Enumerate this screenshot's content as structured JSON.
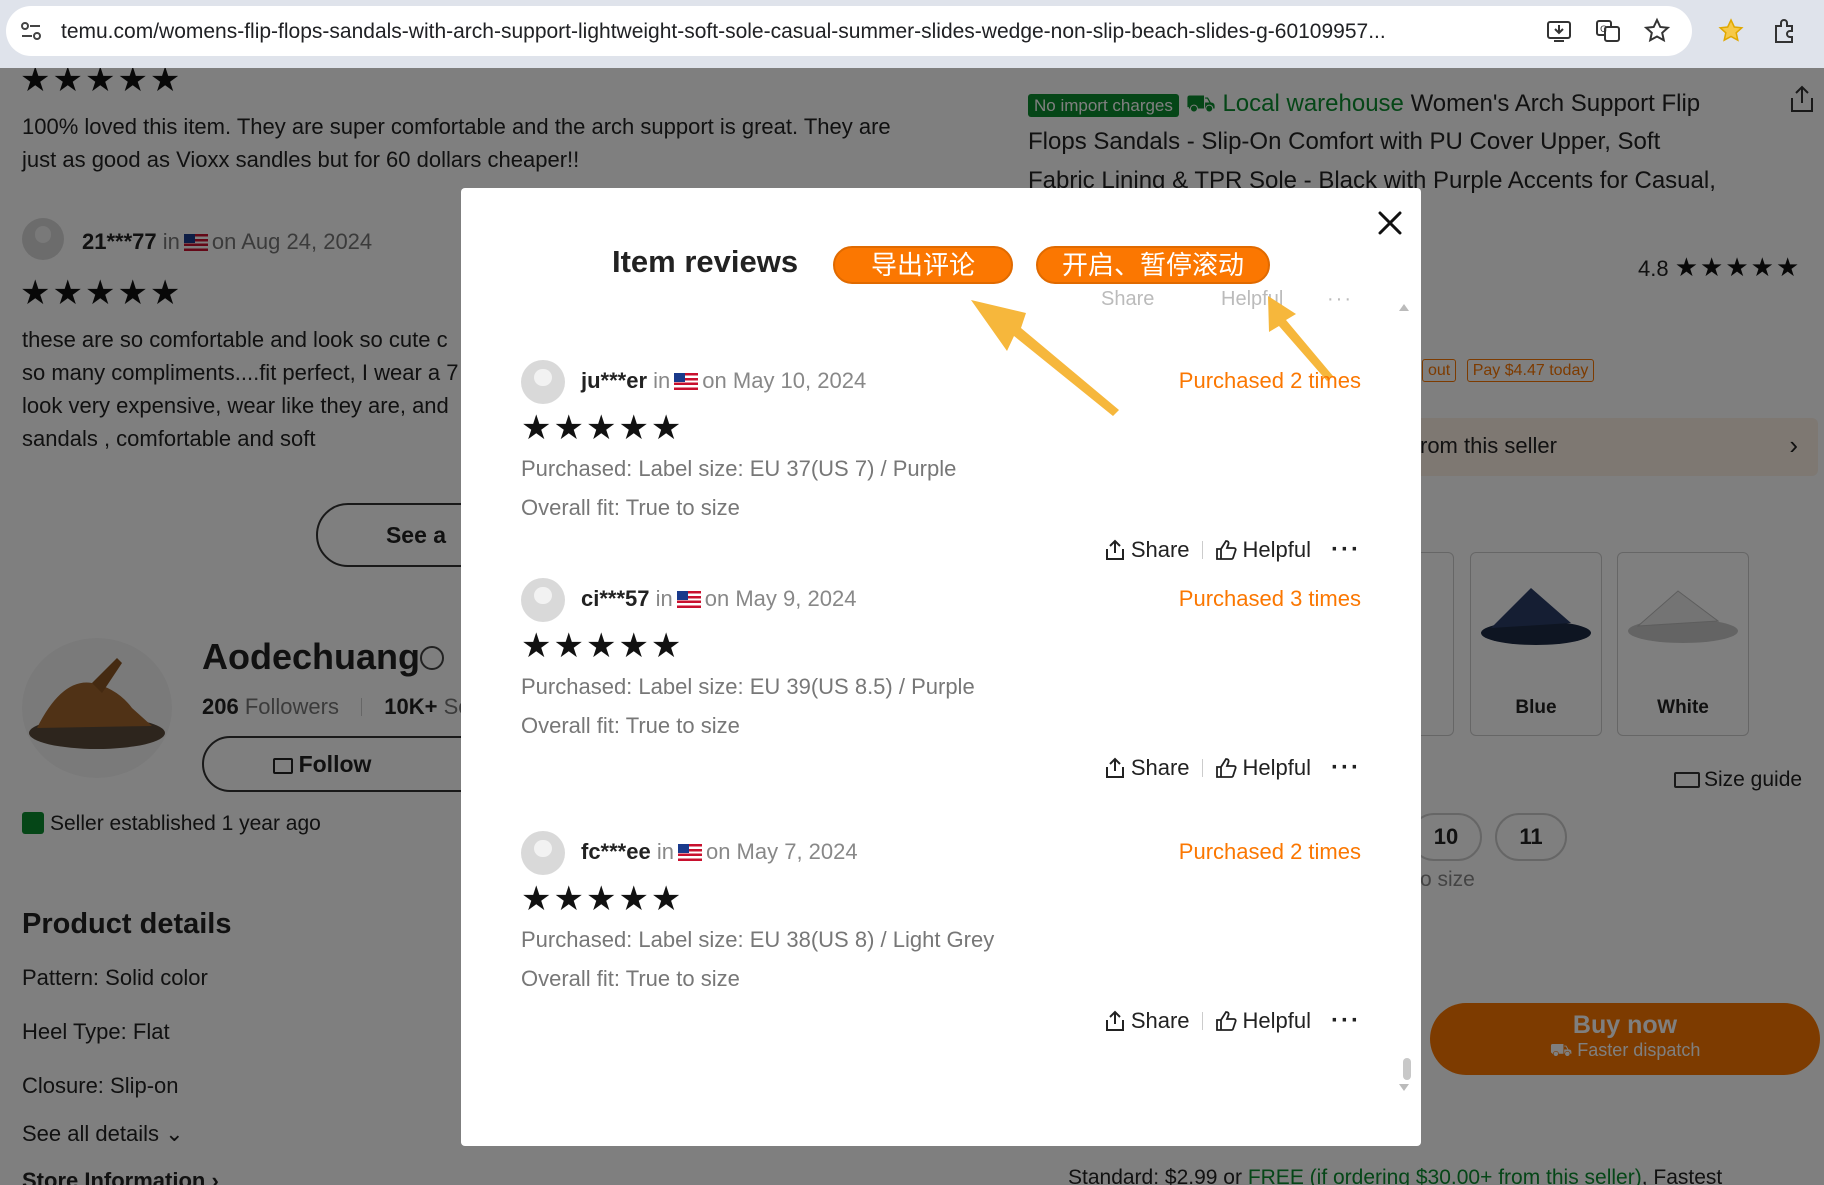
{
  "browser": {
    "url": "temu.com/womens-flip-flops-sandals-with-arch-support-lightweight-soft-sole-casual-summer-slides-wedge-non-slip-beach-slides-g-60109957..."
  },
  "background": {
    "top_review": {
      "text_line1": "100% loved this item. They are super comfortable and the arch support is great. They are",
      "text_line2": "just as good as Vioxx sandles but for 60 dollars cheaper!!"
    },
    "second_review": {
      "name": "21***77",
      "in": "in",
      "date": "on Aug 24, 2024",
      "lines": [
        "these are so comfortable and look so cute c",
        "so many compliments....fit perfect, I wear a 7",
        "look very expensive, wear like they are, and",
        "sandals , comfortable and soft"
      ]
    },
    "see_all_label": "See a",
    "store": {
      "name": "Aodechuang",
      "followers_count": "206",
      "followers_label": "Followers",
      "sold_count": "10K+",
      "sold_label": "Sc",
      "follow_label": "Follow",
      "established": "Seller established 1 year ago"
    },
    "product_details": {
      "heading": "Product details",
      "items": [
        "Pattern: Solid color",
        "Heel Type: Flat",
        "Closure: Slip-on"
      ],
      "see_all": "See all details",
      "store_info": "Store Information"
    },
    "product": {
      "no_import": "No import charges",
      "local_warehouse": "Local warehouse",
      "title_line1": "Women's Arch Support Flip",
      "title_line2": "Flops Sandals - Slip-On Comfort with PU Cover Upper, Soft",
      "title_line3": "Fabric Lining & TPR Sole - Black with Purple Accents for Casual,",
      "rating": "4.8",
      "pay_out": "out",
      "pay_today": "Pay $4.47 today",
      "from_seller": "rom this seller",
      "color_tiles": [
        "Blue",
        "White"
      ],
      "size_guide": "Size guide",
      "sizes": [
        "10",
        "11"
      ],
      "size_note": "o size",
      "buy_now": "Buy now",
      "faster_dispatch": "Faster dispatch",
      "shipping_prefix": "Standard: $2.99 or",
      "shipping_free": "FREE (if ordering $30.00+ from this seller)",
      "shipping_suffix": ", Fastest"
    }
  },
  "modal": {
    "title": "Item reviews",
    "export_button": "导出评论",
    "scroll_button": "开启、暂停滚动",
    "ghost_share": "Share",
    "ghost_helpful": "Helpful",
    "reviews": [
      {
        "name": "ju***er",
        "in": "in",
        "date": "on May 10, 2024",
        "purchased_times": "Purchased 2 times",
        "stars": "★★★★★",
        "purchase_info": "Purchased: Label size: EU 37(US 7) / Purple",
        "fit": "Overall fit: True to size",
        "share": "Share",
        "helpful": "Helpful"
      },
      {
        "name": "ci***57",
        "in": "in",
        "date": "on May 9, 2024",
        "purchased_times": "Purchased 3 times",
        "stars": "★★★★★",
        "purchase_info": "Purchased: Label size: EU 39(US 8.5) / Purple",
        "fit": "Overall fit: True to size",
        "share": "Share",
        "helpful": "Helpful"
      },
      {
        "name": "fc***ee",
        "in": "in",
        "date": "on May 7, 2024",
        "purchased_times": "Purchased 2 times",
        "stars": "★★★★★",
        "purchase_info": "Purchased: Label size: EU 38(US 8) / Light Grey",
        "fit": "Overall fit: True to size",
        "share": "Share",
        "helpful": "Helpful"
      }
    ]
  },
  "colors": {
    "accent_orange": "#fb7701",
    "annotation_arrow": "#f6b73c",
    "green": "#0a8c2e"
  }
}
